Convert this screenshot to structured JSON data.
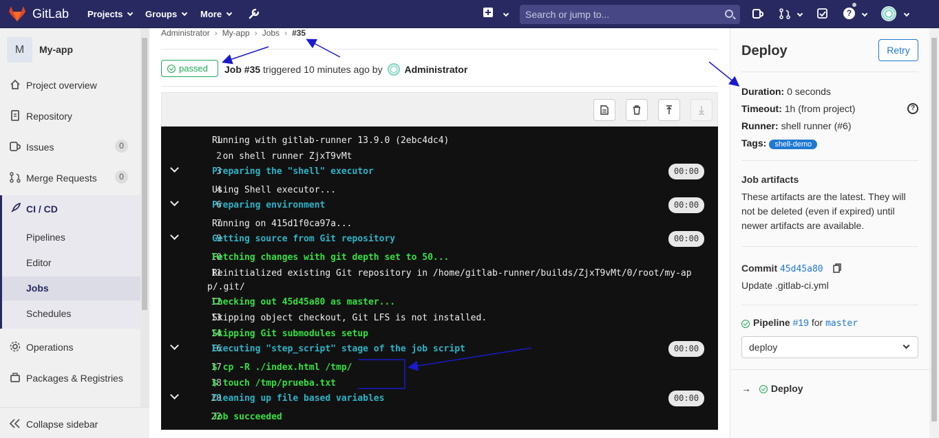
{
  "topbar": {
    "brand": "GitLab",
    "nav": [
      "Projects",
      "Groups",
      "More"
    ],
    "search_placeholder": "Search or jump to..."
  },
  "sidebar": {
    "project_initial": "M",
    "project_name": "My-app",
    "items": [
      {
        "label": "Project overview"
      },
      {
        "label": "Repository"
      },
      {
        "label": "Issues",
        "count": "0"
      },
      {
        "label": "Merge Requests",
        "count": "0"
      },
      {
        "label": "CI / CD"
      }
    ],
    "cicd_sub": [
      "Pipelines",
      "Editor",
      "Jobs",
      "Schedules"
    ],
    "lower_items": [
      "Operations",
      "Packages & Registries"
    ],
    "collapse": "Collapse sidebar"
  },
  "breadcrumb": [
    "Administrator",
    "My-app",
    "Jobs",
    "#35"
  ],
  "job": {
    "status": "passed",
    "title": "Job #35",
    "triggered": "triggered 10 minutes ago by",
    "user": "Administrator"
  },
  "log": [
    {
      "n": "1",
      "text": "Running with gitlab-runner 13.9.0 (2ebc4dc4)",
      "style": "white"
    },
    {
      "n": "2",
      "text": "  on shell runner ZjxT9vMt",
      "style": "white"
    },
    {
      "n": "3",
      "text": "Preparing the \"shell\" executor",
      "style": "cyan",
      "section": true,
      "dur": "00:00"
    },
    {
      "n": "4",
      "text": "Using Shell executor...",
      "style": "white"
    },
    {
      "n": "6",
      "text": "Preparing environment",
      "style": "cyan",
      "section": true,
      "dur": "00:00"
    },
    {
      "n": "7",
      "text": "Running on 415d1f0ca97a...",
      "style": "white"
    },
    {
      "n": "9",
      "text": "Getting source from Git repository",
      "style": "cyan",
      "section": true,
      "dur": "00:00"
    },
    {
      "n": "10",
      "text": "Fetching changes with git depth set to 50...",
      "style": "green"
    },
    {
      "n": "11",
      "text": "Reinitialized existing Git repository in /home/gitlab-runner/builds/ZjxT9vMt/0/root/my-ap",
      "style": "white"
    },
    {
      "n": "",
      "text": "p/.git/",
      "style": "white"
    },
    {
      "n": "12",
      "text": "Checking out 45d45a80 as master...",
      "style": "green"
    },
    {
      "n": "13",
      "text": "Skipping object checkout, Git LFS is not installed.",
      "style": "white"
    },
    {
      "n": "14",
      "text": "Skipping Git submodules setup",
      "style": "green"
    },
    {
      "n": "16",
      "text": "Executing \"step_script\" stage of the job script",
      "style": "cyan",
      "section": true,
      "dur": "00:00"
    },
    {
      "n": "17",
      "text": "$ cp -R ./index.html /tmp/",
      "style": "green"
    },
    {
      "n": "18",
      "text": "$ touch /tmp/prueba.txt",
      "style": "green"
    },
    {
      "n": "20",
      "text": "Cleaning up file based variables",
      "style": "cyan",
      "section": true,
      "dur": "00:00"
    },
    {
      "n": "22",
      "text": "Job succeeded",
      "style": "green"
    }
  ],
  "right": {
    "title": "Deploy",
    "retry": "Retry",
    "duration_k": "Duration:",
    "duration_v": "0 seconds",
    "timeout_k": "Timeout:",
    "timeout_v": "1h (from project)",
    "runner_k": "Runner:",
    "runner_v": "shell runner (#6)",
    "tags_k": "Tags:",
    "tag": "shell-demo",
    "artifacts_title": "Job artifacts",
    "artifacts_text": "These artifacts are the latest. They will not be deleted (even if expired) until newer artifacts are available.",
    "commit_k": "Commit",
    "commit_sha": "45d45a80",
    "commit_msg": "Update .gitlab-ci.yml",
    "pipeline_k": "Pipeline",
    "pipeline_id": "#19",
    "pipeline_for": "for",
    "branch": "master",
    "stage_select": "deploy",
    "job_item": "Deploy"
  }
}
